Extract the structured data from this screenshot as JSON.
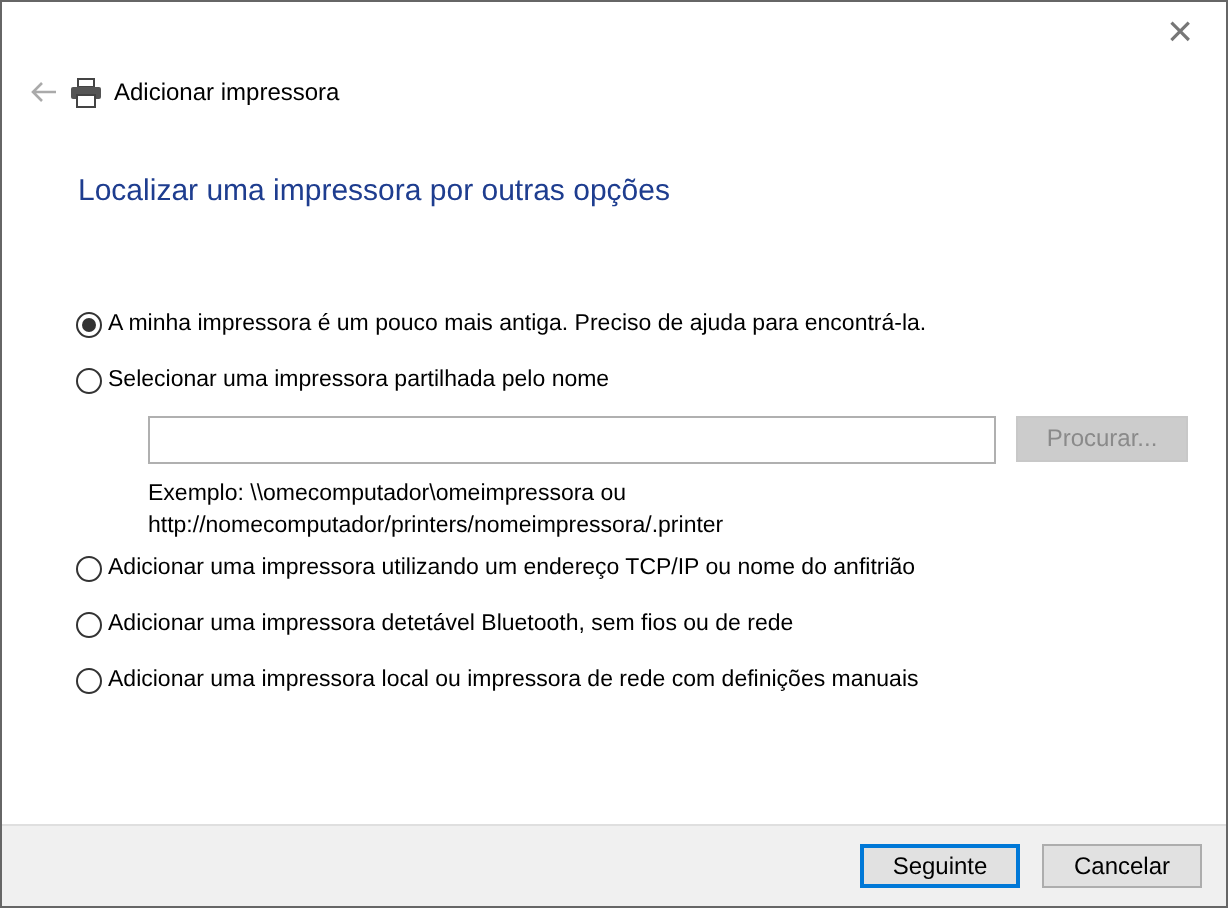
{
  "window": {
    "title": "Adicionar impressora",
    "close": "×"
  },
  "heading": "Localizar uma impressora por outras opções",
  "options": [
    {
      "label": "A minha impressora é um pouco mais antiga. Preciso de ajuda para encontrá-la.",
      "selected": true
    },
    {
      "label": "Selecionar uma impressora partilhada pelo nome",
      "selected": false,
      "share": {
        "browse": {
          "label": "Procurar...",
          "disabled": true
        },
        "example": [
          "Exemplo: \\\\omecomputador\\omeimpressora ou",
          "http://nomecomputador/printers/nomeimpressora/.printer"
        ]
      }
    },
    {
      "label": "Adicionar uma impressora utilizando um endereço TCP/IP ou nome do anfitrião",
      "selected": false
    },
    {
      "label": "Adicionar uma impressora detetável Bluetooth, sem fios ou de rede",
      "selected": false
    },
    {
      "label": "Adicionar uma impressora local ou impressora de rede com definições manuais",
      "selected": false
    }
  ],
  "buttons": [
    {
      "label": "Seguinte",
      "default": true
    },
    {
      "label": "Cancelar",
      "default": false
    }
  ]
}
